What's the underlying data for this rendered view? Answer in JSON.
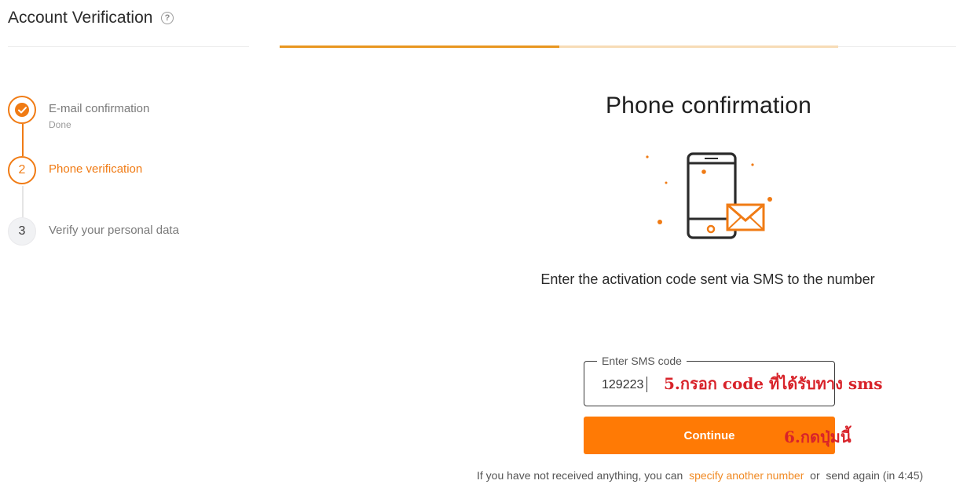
{
  "header": {
    "title": "Account Verification",
    "help_icon": "?"
  },
  "progress": {
    "fraction": 0.5,
    "fill_color": "#e8961f",
    "track_color": "#f7dcb6"
  },
  "steps": [
    {
      "number": "",
      "label": "E-mail confirmation",
      "sub": "Done",
      "state": "done"
    },
    {
      "number": "2",
      "label": "Phone verification",
      "sub": "",
      "state": "active"
    },
    {
      "number": "3",
      "label": "Verify your personal data",
      "sub": "",
      "state": "pending"
    }
  ],
  "main": {
    "title": "Phone confirmation",
    "illustration_icon": "phone-sms-icon",
    "instruction": "Enter the activation code sent via SMS to the number",
    "sms_field": {
      "legend": "Enter SMS code",
      "value": "129223"
    },
    "continue_label": "Continue",
    "resend": {
      "prefix": "If you have not received anything, you can",
      "link_text": "specify another number",
      "middle": "or",
      "suffix": "send again (in 4:45)"
    }
  },
  "annotations": {
    "field_note": "5.กรอก code ที่ได้รับทาง sms",
    "button_note": "6.กดปุ่มนี้"
  },
  "colors": {
    "accent": "#f07b14",
    "button": "#ff7a05",
    "annotation": "#d8232a"
  }
}
